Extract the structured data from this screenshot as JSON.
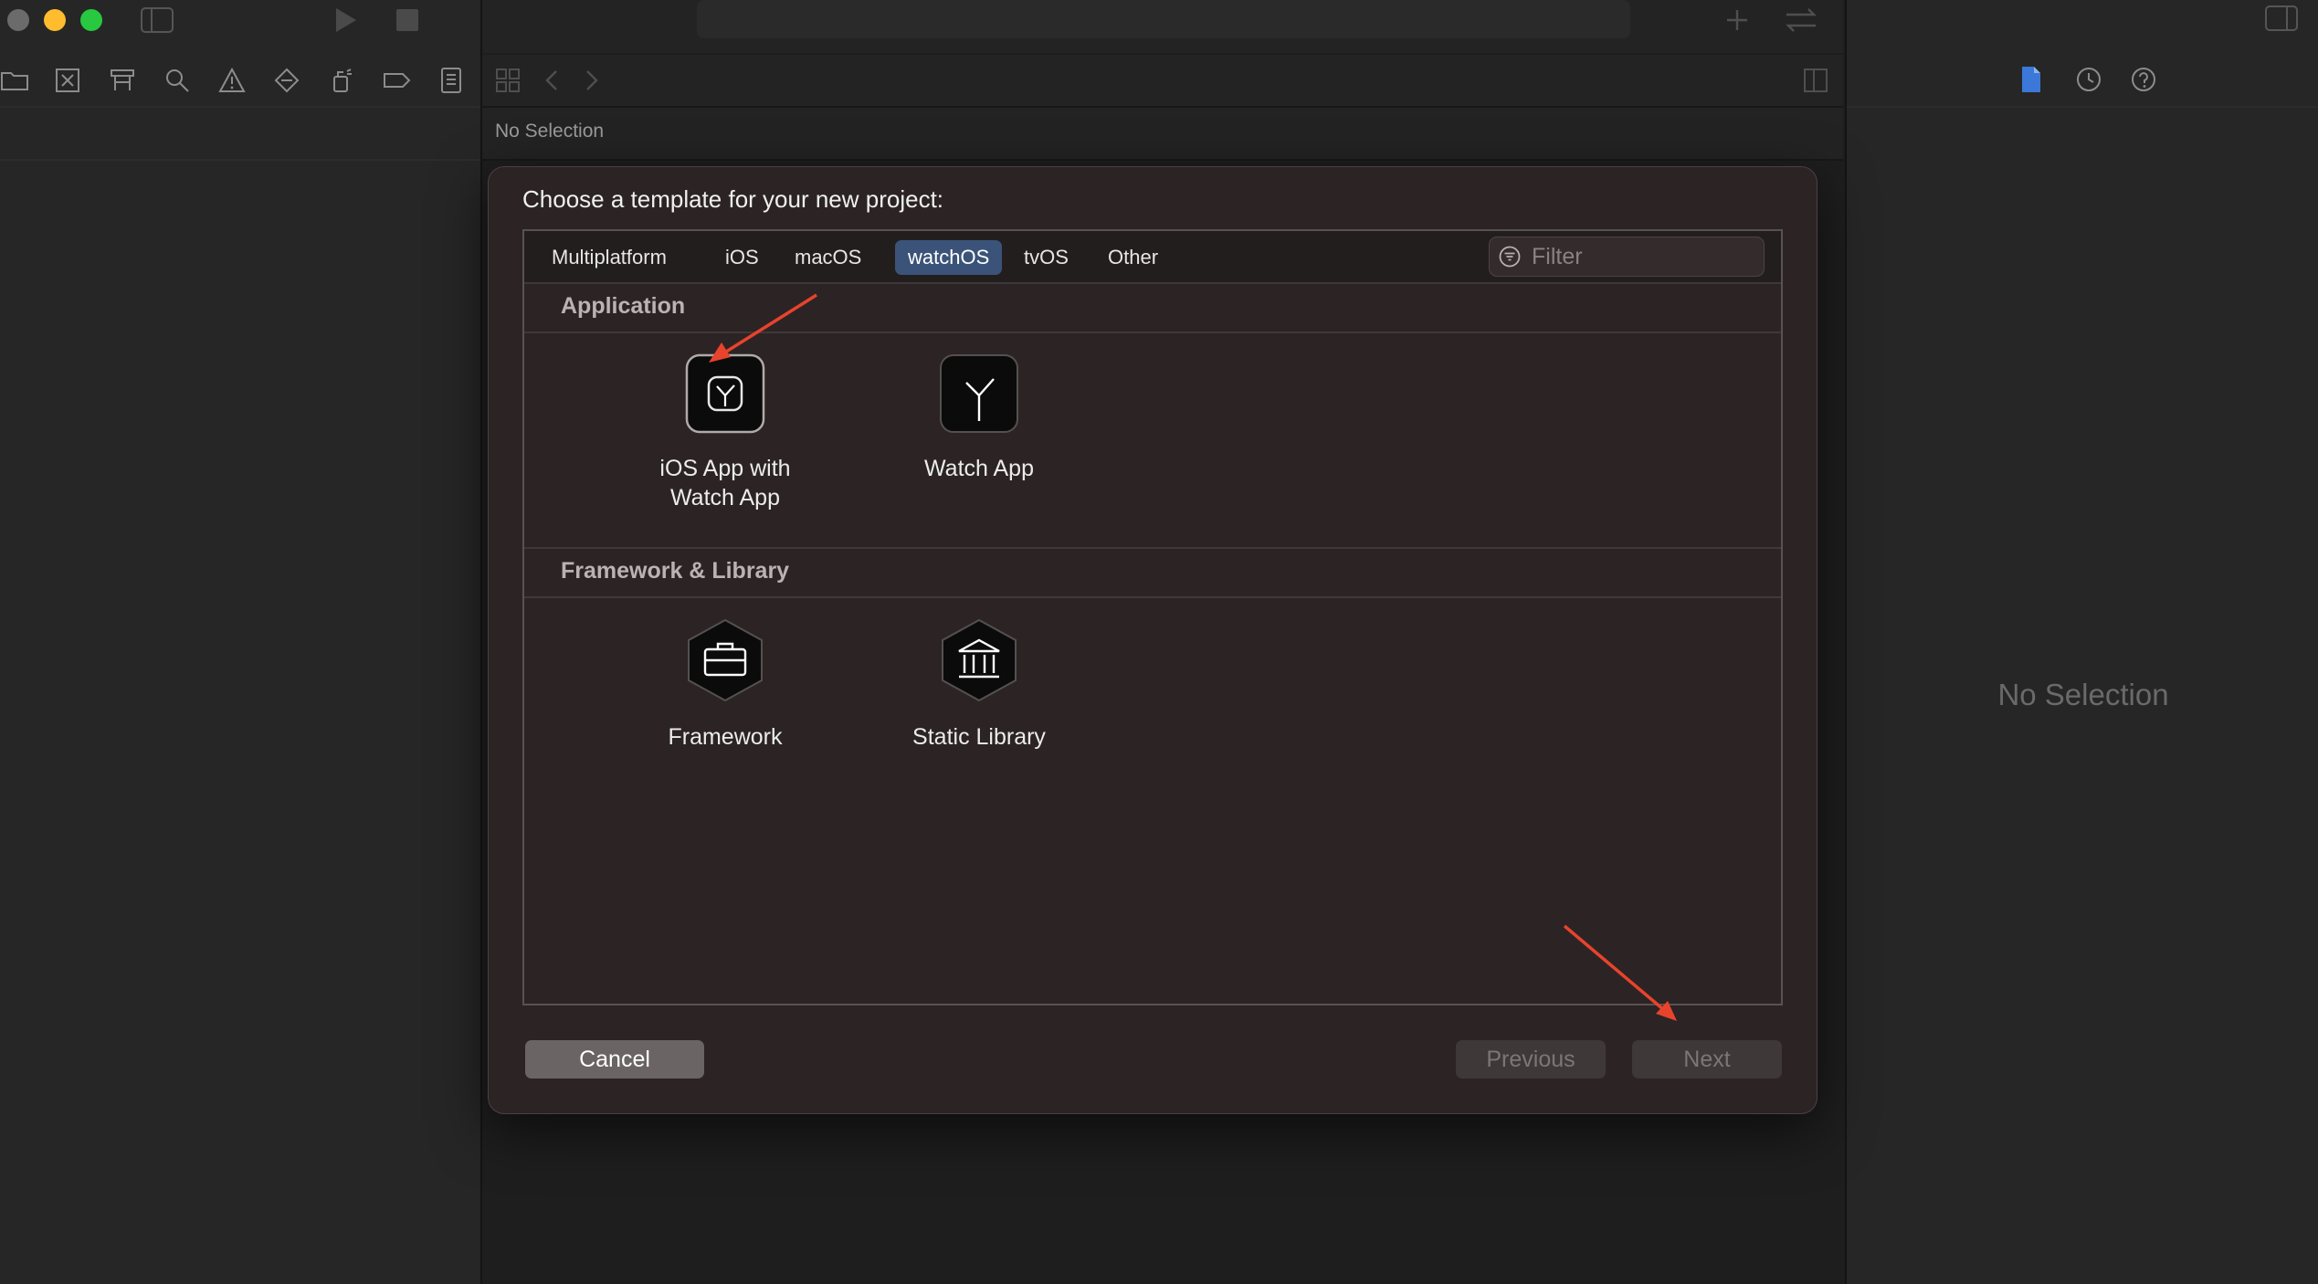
{
  "editor": {
    "no_selection": "No Selection"
  },
  "inspector": {
    "no_selection": "No Selection"
  },
  "dialog": {
    "title": "Choose a template for your new project:",
    "tabs": [
      {
        "label": "Multiplatform",
        "selected": false
      },
      {
        "label": "iOS",
        "selected": false
      },
      {
        "label": "macOS",
        "selected": false
      },
      {
        "label": "watchOS",
        "selected": true
      },
      {
        "label": "tvOS",
        "selected": false
      },
      {
        "label": "Other",
        "selected": false
      }
    ],
    "filter_placeholder": "Filter",
    "sections": [
      {
        "title": "Application",
        "templates": [
          {
            "label_line1": "iOS App with",
            "label_line2": "Watch App",
            "icon": "watch-face-icon"
          },
          {
            "label_line1": "Watch App",
            "icon": "watch-hands-icon"
          }
        ]
      },
      {
        "title": "Framework & Library",
        "templates": [
          {
            "label_line1": "Framework",
            "icon": "toolbox-icon"
          },
          {
            "label_line1": "Static Library",
            "icon": "library-building-icon"
          }
        ]
      }
    ],
    "buttons": {
      "cancel": "Cancel",
      "previous": "Previous",
      "next": "Next"
    }
  },
  "annotations": {
    "arrow_color": "#e8432d"
  },
  "colors": {
    "selected_tab": "#3b5378",
    "window_traffic": [
      "#ff5f57",
      "#febc2e",
      "#28c840"
    ]
  }
}
